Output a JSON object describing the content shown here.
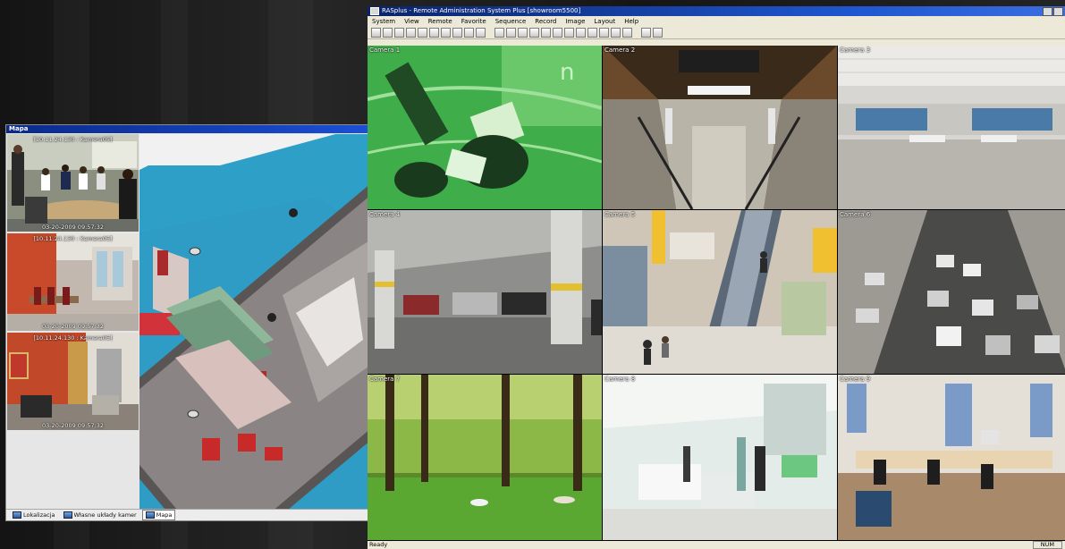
{
  "mapa": {
    "title": "Mapa",
    "thumbs": [
      {
        "top": "[10.11.24.130 : Kamera05]",
        "bottom": "03-20-2009 09:57:32"
      },
      {
        "top": "[10.11.24.130 : Kamera05]",
        "bottom": "03-20-2009 09:57:32"
      },
      {
        "top": "[10.11.24.130 : Kamera05]",
        "bottom": "03-20-2009 09:57:32"
      }
    ],
    "tabs": [
      "Lokalizacja",
      "Własne układy kamer",
      "Mapa"
    ],
    "active_tab": "Mapa"
  },
  "ras": {
    "title": "RASplus - Remote Administration System Plus [showroom5500]",
    "menu": [
      "System",
      "View",
      "Remote",
      "Favorite",
      "Sequence",
      "Record",
      "Image",
      "Layout",
      "Help"
    ],
    "toolbar_icons": [
      "layout-icon",
      "record-icon",
      "playback-icon",
      "export-icon",
      "favorite-star-icon",
      "copy-icon",
      "print-icon",
      "network-icon",
      "record-dot-icon",
      "snapshot-icon",
      "single-view-icon",
      "quad-view-icon",
      "six-view-icon",
      "nine-view-icon",
      "ten-view-icon",
      "thirteen-view-icon",
      "sixteen-view-icon",
      "twenty-view-icon",
      "twentyfive-view-icon",
      "fullscreen-icon",
      "previous-icon",
      "next-icon",
      "sequence-icon",
      "ptz-icon"
    ],
    "cameras": [
      "Camera 1",
      "Camera 2",
      "Camera 3",
      "Camera 4",
      "Camera 5",
      "Camera 6",
      "Camera 7",
      "Camera 8",
      "Camera 9"
    ],
    "status": "Ready",
    "status_num": "NUM"
  },
  "colors": {
    "title_blue": "#0a246a",
    "window_bg": "#ece9d8",
    "floor_blue": "#2ea0c8"
  }
}
